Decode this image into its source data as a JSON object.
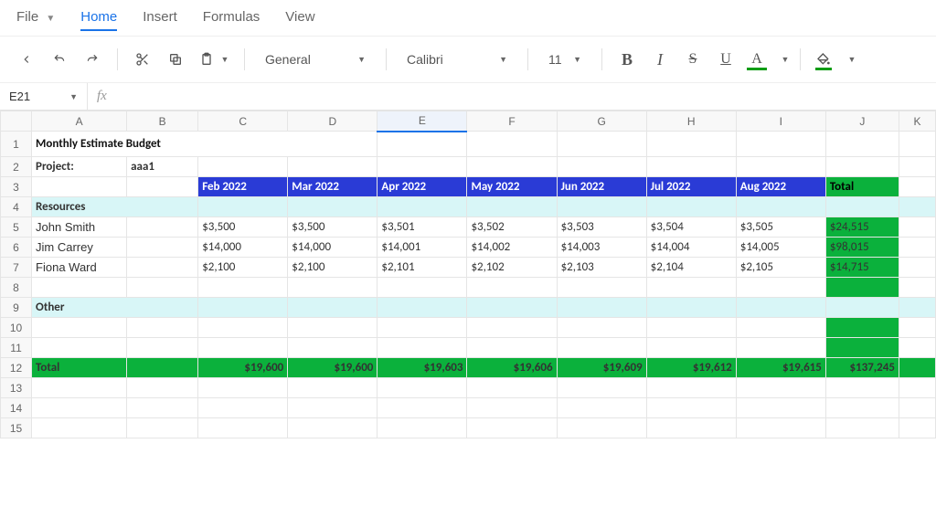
{
  "menu": {
    "file": "File",
    "home": "Home",
    "insert": "Insert",
    "formulas": "Formulas",
    "view": "View"
  },
  "toolbar": {
    "number_format": "General",
    "font_name": "Calibri",
    "font_size": "11"
  },
  "namebox": {
    "ref": "E21"
  },
  "formula_bar": {
    "fx": "fx",
    "value": ""
  },
  "columns": [
    "A",
    "B",
    "C",
    "D",
    "E",
    "F",
    "G",
    "H",
    "I",
    "J",
    "K"
  ],
  "selected_column": "E",
  "row_count": 15,
  "sheet": {
    "title": "Monthly Estimate Budget",
    "project_label": "Project:",
    "project_value": "aaa1",
    "months": [
      "Feb 2022",
      "Mar 2022",
      "Apr 2022",
      "May 2022",
      "Jun 2022",
      "Jul 2022",
      "Aug 2022"
    ],
    "total_label": "Total",
    "section_resources": "Resources",
    "section_other": "Other",
    "rows": [
      {
        "name": "John Smith",
        "values": [
          "$3,500",
          "$3,500",
          "$3,501",
          "$3,502",
          "$3,503",
          "$3,504",
          "$3,505"
        ],
        "total": "$24,515"
      },
      {
        "name": "Jim Carrey",
        "values": [
          "$14,000",
          "$14,000",
          "$14,001",
          "$14,002",
          "$14,003",
          "$14,004",
          "$14,005"
        ],
        "total": "$98,015"
      },
      {
        "name": "Fiona Ward",
        "values": [
          "$2,100",
          "$2,100",
          "$2,101",
          "$2,102",
          "$2,103",
          "$2,104",
          "$2,105"
        ],
        "total": "$14,715"
      }
    ],
    "totals_row": {
      "label": "Total",
      "values": [
        "$19,600",
        "$19,600",
        "$19,603",
        "$19,606",
        "$19,609",
        "$19,612",
        "$19,615"
      ],
      "grand": "$137,245"
    }
  },
  "chart_data": {
    "type": "table",
    "title": "Monthly Estimate Budget",
    "categories": [
      "Feb 2022",
      "Mar 2022",
      "Apr 2022",
      "May 2022",
      "Jun 2022",
      "Jul 2022",
      "Aug 2022"
    ],
    "series": [
      {
        "name": "John Smith",
        "values": [
          3500,
          3500,
          3501,
          3502,
          3503,
          3504,
          3505
        ],
        "total": 24515
      },
      {
        "name": "Jim Carrey",
        "values": [
          14000,
          14000,
          14001,
          14002,
          14003,
          14004,
          14005
        ],
        "total": 98015
      },
      {
        "name": "Fiona Ward",
        "values": [
          2100,
          2100,
          2101,
          2102,
          2103,
          2104,
          2105
        ],
        "total": 14715
      }
    ],
    "column_totals": [
      19600,
      19600,
      19603,
      19606,
      19609,
      19612,
      19615
    ],
    "grand_total": 137245
  }
}
